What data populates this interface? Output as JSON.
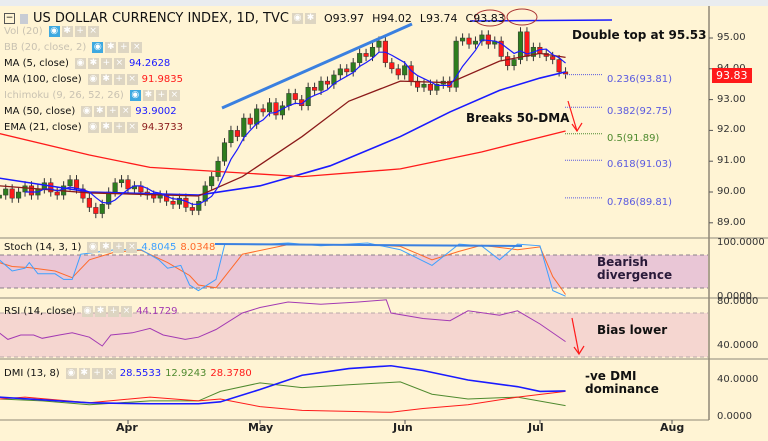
{
  "header": {
    "title": "US DOLLAR CURRENCY INDEX, 1D, TVC",
    "open": "O93.97",
    "high": "H94.02",
    "low": "L93.74",
    "close": "C93.83"
  },
  "legend": [
    {
      "label": "Vol (20)",
      "value": "",
      "dim": true,
      "color": "#000000"
    },
    {
      "label": "BB (20, close, 2)",
      "value": "",
      "dim": true,
      "color": "#000000"
    },
    {
      "label": "MA (5, close)",
      "value": "94.2628",
      "dim": false,
      "color": "#1a1aff"
    },
    {
      "label": "MA (100, close)",
      "value": "91.9835",
      "dim": false,
      "color": "#ff1a1a"
    },
    {
      "label": "Ichimoku (9, 26, 52, 26)",
      "value": "",
      "dim": true,
      "color": "#000000"
    },
    {
      "label": "MA (50, close)",
      "value": "93.9002",
      "dim": false,
      "color": "#1a1aff"
    },
    {
      "label": "EMA (21, close)",
      "value": "94.3733",
      "dim": false,
      "color": "#8b1a1a"
    }
  ],
  "last_price": "93.83",
  "annotations": {
    "double_top": "Double top at 95.53",
    "breaks": "Breaks 50-DMA",
    "bearish_1": "Bearish",
    "bearish_2": "divergence",
    "bias": "Bias lower",
    "dmi_1": "-ve DMI",
    "dmi_2": "dominance"
  },
  "fib_levels": [
    {
      "label": "0.236(93.81)",
      "price": 93.81,
      "color": "#5a5ae0"
    },
    {
      "label": "0.382(92.75)",
      "price": 92.75,
      "color": "#5a5ae0"
    },
    {
      "label": "0.5(91.89)",
      "price": 91.89,
      "color": "#4f8a2f"
    },
    {
      "label": "0.618(91.03)",
      "price": 91.03,
      "color": "#5a5ae0"
    },
    {
      "label": "0.786(89.81)",
      "price": 89.81,
      "color": "#5a5ae0"
    }
  ],
  "chart_data": {
    "type": "candlestick",
    "x_ticks": [
      "Apr",
      "May",
      "Jun",
      "Jul",
      "Aug"
    ],
    "price_ticks": [
      "95.00",
      "94.00",
      "93.00",
      "92.00",
      "91.00",
      "90.00",
      "89.00"
    ],
    "candles": {
      "from": "Mar 2",
      "to": "Jul 7",
      "close": [
        89.9,
        90.1,
        89.8,
        90.0,
        90.2,
        89.9,
        90.1,
        90.3,
        90.0,
        89.9,
        90.2,
        90.4,
        90.1,
        89.8,
        89.5,
        89.3,
        89.6,
        90.0,
        90.3,
        90.4,
        90.1,
        90.2,
        90.0,
        89.9,
        89.8,
        89.9,
        89.7,
        89.6,
        89.8,
        89.5,
        89.4,
        89.7,
        90.2,
        90.5,
        91.0,
        91.6,
        92.0,
        91.8,
        92.4,
        92.2,
        92.7,
        92.6,
        92.9,
        92.5,
        92.8,
        93.2,
        93.0,
        92.8,
        93.4,
        93.3,
        93.6,
        93.5,
        93.8,
        94.0,
        93.9,
        94.2,
        94.5,
        94.4,
        94.7,
        94.9,
        94.2,
        94.0,
        93.8,
        94.1,
        93.6,
        93.4,
        93.5,
        93.3,
        93.5,
        93.6,
        93.4,
        94.9,
        95.0,
        94.8,
        94.9,
        95.1,
        94.8,
        94.9,
        94.4,
        94.1,
        94.3,
        95.2,
        94.4,
        94.7,
        94.5,
        94.4,
        94.3,
        93.9,
        93.83
      ]
    },
    "lines": [
      {
        "name": "MA (50, close)",
        "color": "#1a1aff",
        "width": 1.6,
        "points": [
          [
            "Mar 2",
            90.45
          ],
          [
            "Mar 23",
            90.0
          ],
          [
            "Apr 17",
            89.9
          ],
          [
            "May 1",
            90.2
          ],
          [
            "May 16",
            90.85
          ],
          [
            "May 31",
            91.8
          ],
          [
            "Jun 11",
            92.6
          ],
          [
            "Jun 22",
            93.3
          ],
          [
            "Jul 1",
            93.7
          ],
          [
            "Jul 7",
            93.9
          ]
        ]
      },
      {
        "name": "MA (100, close)",
        "color": "#ff1a1a",
        "width": 1.3,
        "points": [
          [
            "Mar 2",
            91.9
          ],
          [
            "Mar 23",
            91.2
          ],
          [
            "Apr 6",
            90.8
          ],
          [
            "May 10",
            90.5
          ],
          [
            "May 31",
            90.75
          ],
          [
            "Jun 18",
            91.3
          ],
          [
            "Jul 7",
            91.98
          ]
        ]
      },
      {
        "name": "EMA (21, close)",
        "color": "#8b1a1a",
        "width": 1.3,
        "points": [
          [
            "Mar 2",
            90.2
          ],
          [
            "Mar 23",
            89.97
          ],
          [
            "Apr 17",
            89.87
          ],
          [
            "Apr 27",
            90.5
          ],
          [
            "May 10",
            91.8
          ],
          [
            "May 20",
            92.95
          ],
          [
            "May 31",
            93.6
          ],
          [
            "Jun 11",
            93.55
          ],
          [
            "Jun 22",
            94.25
          ],
          [
            "Jul 1",
            94.5
          ],
          [
            "Jul 7",
            94.37
          ]
        ]
      }
    ],
    "stoch": {
      "label": "Stoch (14, 3, 1)",
      "k_value": "4.8045",
      "d_value": "8.0348",
      "ticks": [
        "100.0000",
        "0.0000"
      ],
      "k_color": "#3ea0ff",
      "d_color": "#ff6a2a",
      "k": [
        [
          "Mar 2",
          70
        ],
        [
          "Mar 5",
          50
        ],
        [
          "Mar 8",
          55
        ],
        [
          "Mar 9",
          65
        ],
        [
          "Mar 11",
          45
        ],
        [
          "Mar 15",
          45
        ],
        [
          "Mar 17",
          35
        ],
        [
          "Mar 19",
          35
        ],
        [
          "Mar 21",
          80
        ],
        [
          "Mar 23",
          82
        ],
        [
          "Mar 26",
          85
        ],
        [
          "Mar 29",
          88
        ],
        [
          "Apr 4",
          88
        ],
        [
          "Apr 8",
          70
        ],
        [
          "Apr 10",
          55
        ],
        [
          "Apr 13",
          60
        ],
        [
          "Apr 15",
          25
        ],
        [
          "Apr 17",
          15
        ],
        [
          "Apr 21",
          35
        ],
        [
          "Apr 23",
          98
        ],
        [
          "May 1",
          97
        ],
        [
          "May 7",
          100
        ],
        [
          "May 14",
          95
        ],
        [
          "May 24",
          100
        ],
        [
          "May 31",
          88
        ],
        [
          "Jun 7",
          60
        ],
        [
          "Jun 13",
          98
        ],
        [
          "Jun 18",
          95
        ],
        [
          "Jun 22",
          70
        ],
        [
          "Jun 26",
          98
        ],
        [
          "Jul 1",
          95
        ],
        [
          "Jul 4",
          15
        ],
        [
          "Jul 7",
          5
        ]
      ],
      "d": [
        [
          "Mar 2",
          65
        ],
        [
          "Mar 5",
          58
        ],
        [
          "Mar 9",
          56
        ],
        [
          "Mar 15",
          50
        ],
        [
          "Mar 19",
          38
        ],
        [
          "Mar 23",
          70
        ],
        [
          "Mar 29",
          84
        ],
        [
          "Apr 4",
          87
        ],
        [
          "Apr 10",
          65
        ],
        [
          "Apr 15",
          42
        ],
        [
          "Apr 17",
          25
        ],
        [
          "Apr 21",
          20
        ],
        [
          "Apr 27",
          80
        ],
        [
          "May 7",
          97
        ],
        [
          "May 24",
          97
        ],
        [
          "May 31",
          94
        ],
        [
          "Jun 7",
          70
        ],
        [
          "Jun 13",
          85
        ],
        [
          "Jun 18",
          96
        ],
        [
          "Jun 26",
          88
        ],
        [
          "Jul 1",
          93
        ],
        [
          "Jul 4",
          40
        ],
        [
          "Jul 7",
          8
        ]
      ]
    },
    "rsi": {
      "label": "RSI (14, close)",
      "value": "44.1729",
      "ticks": [
        "80.0000",
        "40.0000"
      ],
      "color": "#a33ab3",
      "points": [
        [
          "Mar 2",
          52
        ],
        [
          "Mar 4",
          46
        ],
        [
          "Mar 7",
          50
        ],
        [
          "Mar 10",
          50
        ],
        [
          "Mar 12",
          47
        ],
        [
          "Mar 16",
          50
        ],
        [
          "Mar 19",
          52
        ],
        [
          "Mar 23",
          48
        ],
        [
          "Mar 26",
          40
        ],
        [
          "Mar 28",
          50
        ],
        [
          "Apr 2",
          52
        ],
        [
          "Apr 6",
          56
        ],
        [
          "Apr 9",
          50
        ],
        [
          "Apr 14",
          46
        ],
        [
          "Apr 17",
          48
        ],
        [
          "Apr 21",
          55
        ],
        [
          "Apr 27",
          70
        ],
        [
          "May 1",
          75
        ],
        [
          "May 7",
          80
        ],
        [
          "May 14",
          78
        ],
        [
          "May 22",
          80
        ],
        [
          "May 28",
          82
        ],
        [
          "May 29",
          70
        ],
        [
          "Jun 5",
          65
        ],
        [
          "Jun 11",
          63
        ],
        [
          "Jun 15",
          72
        ],
        [
          "Jun 22",
          68
        ],
        [
          "Jun 26",
          72
        ],
        [
          "Jul 1",
          60
        ],
        [
          "Jul 7",
          44
        ]
      ]
    },
    "dmi": {
      "label": "DMI (13, 8)",
      "adx_value": "28.5533",
      "plus_value": "12.9243",
      "minus_value": "28.3780",
      "ticks": [
        "40.0000",
        "0.0000"
      ],
      "adx_color": "#1a1aff",
      "plus_color": "#4f8a2f",
      "minus_color": "#ff1a1a",
      "adx": [
        [
          "Mar 2",
          22
        ],
        [
          "Mar 23",
          16
        ],
        [
          "Apr 6",
          15
        ],
        [
          "Apr 17",
          15
        ],
        [
          "Apr 22",
          17
        ],
        [
          "May 1",
          30
        ],
        [
          "May 10",
          45
        ],
        [
          "May 20",
          52
        ],
        [
          "May 29",
          55
        ],
        [
          "Jun 5",
          50
        ],
        [
          "Jun 15",
          40
        ],
        [
          "Jun 26",
          33
        ],
        [
          "Jul 1",
          28
        ],
        [
          "Jul 7",
          28.5
        ]
      ],
      "plus": [
        [
          "Mar 2",
          20
        ],
        [
          "Mar 12",
          18
        ],
        [
          "Mar 23",
          14
        ],
        [
          "Apr 6",
          18
        ],
        [
          "Apr 17",
          18
        ],
        [
          "Apr 22",
          28
        ],
        [
          "May 1",
          37
        ],
        [
          "May 10",
          32
        ],
        [
          "May 20",
          35
        ],
        [
          "May 31",
          38
        ],
        [
          "Jun 7",
          25
        ],
        [
          "Jun 15",
          20
        ],
        [
          "Jun 26",
          22
        ],
        [
          "Jul 7",
          13
        ]
      ],
      "minus": [
        [
          "Mar 2",
          20
        ],
        [
          "Mar 8",
          22
        ],
        [
          "Mar 23",
          16
        ],
        [
          "Apr 6",
          22
        ],
        [
          "Apr 17",
          18
        ],
        [
          "Apr 22",
          20
        ],
        [
          "May 1",
          12
        ],
        [
          "May 10",
          8
        ],
        [
          "May 20",
          7
        ],
        [
          "May 29",
          6
        ],
        [
          "Jun 5",
          10
        ],
        [
          "Jun 15",
          14
        ],
        [
          "Jun 26",
          22
        ],
        [
          "Jul 7",
          28
        ]
      ]
    }
  },
  "colors": {
    "up": "#2e7d1e",
    "down": "#ff1a1a",
    "background": "#fff4d4",
    "stoch_band": "#e9c6d6",
    "rsi_band": "#f5d6d0"
  }
}
